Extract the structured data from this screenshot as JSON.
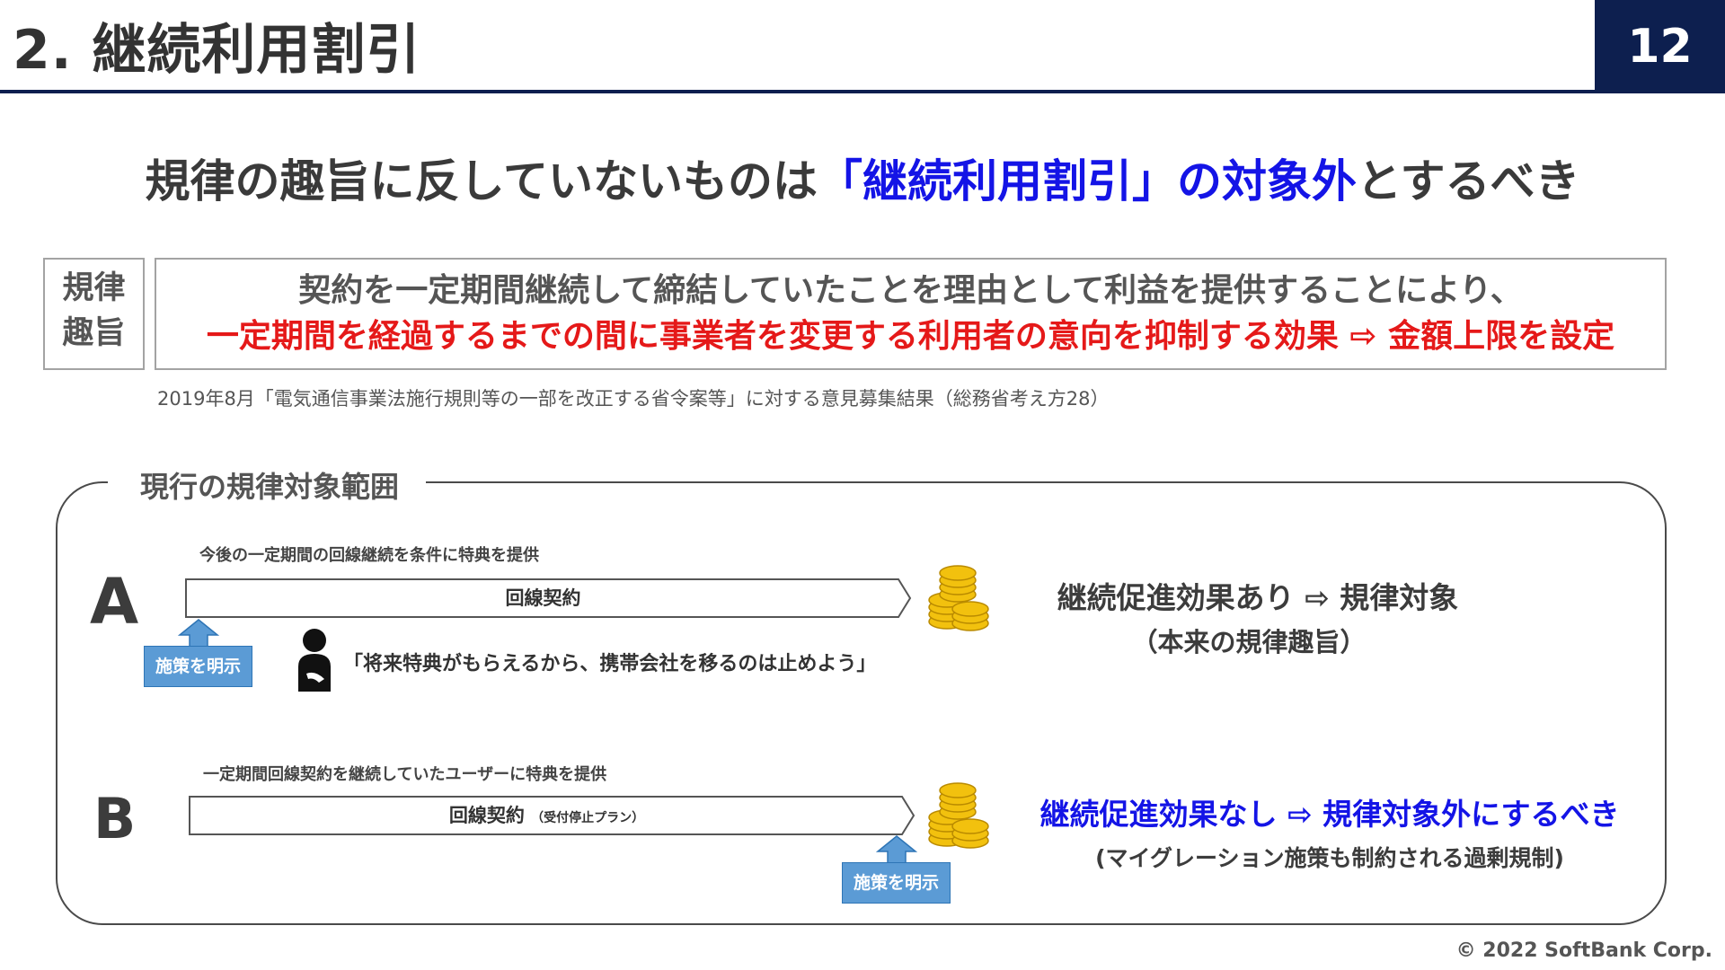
{
  "header": {
    "title": "2. 継続利用割引",
    "page_number": "12"
  },
  "headline": {
    "before": "規律の趣旨に反していないものは",
    "highlight": "「継続利用割引」の対象外",
    "after": "とするべき"
  },
  "purpose": {
    "label_line_1": "規律",
    "label_line_2": "趣旨",
    "line_1": "契約を一定期間継続して締結していたことを理由として利益を提供することにより、",
    "line_2": "一定期間を経過するまでの間に事業者を変更する利用者の意向を抑制する効果 ⇨ 金額上限を設定",
    "source_note": "2019年8月「電気通信事業法施行規則等の一部を改正する省令案等」に対する意見募集結果（総務省考え方28）"
  },
  "scope": {
    "title": "現行の規律対象範囲",
    "case_a": {
      "letter": "A",
      "caption": "今後の一定期間の回線継続を条件に特典を提供",
      "contract_label": "回線契約",
      "measure_button": "施策を明示",
      "quote": "「将来特典がもらえるから、携帯会社を移るのは止めよう」",
      "effect_main": "継続促進効果あり ⇨ 規律対象",
      "effect_sub": "（本来の規律趣旨）"
    },
    "case_b": {
      "letter": "B",
      "caption": "一定期間回線契約を継続していたユーザーに特典を提供",
      "contract_label": "回線契約",
      "contract_note": "（受付停止プラン）",
      "measure_button": "施策を明示",
      "effect_main": "継続促進効果なし ⇨ 規律対象外にするべき",
      "effect_sub": "(マイグレーション施策も制約される過剰規制)"
    }
  },
  "footer": {
    "copyright": "© 2022 SoftBank Corp."
  },
  "colors": {
    "navy": "#0d1f4f",
    "accent_blue": "#1414e6",
    "accent_red": "#e51919",
    "button_blue": "#5b9bd5",
    "coin_gold": "#f2c10e"
  },
  "icons": {
    "coins": "coin-stack-icon",
    "person": "person-icon",
    "arrow": "arrow-up-icon"
  }
}
